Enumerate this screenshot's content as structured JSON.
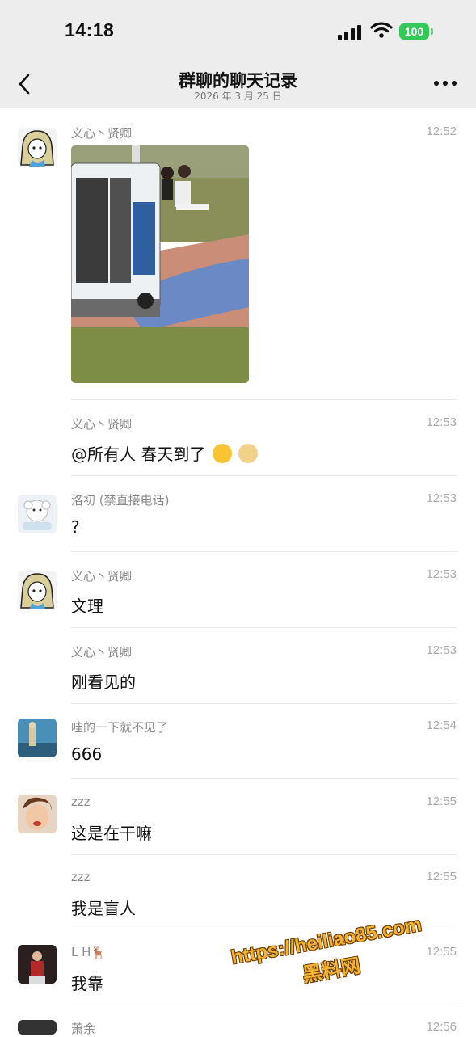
{
  "status_bar": {
    "time": "14:18",
    "battery": "100"
  },
  "nav": {
    "title": "群聊的聊天记录",
    "subtitle": "2026 年 3 月 25 日",
    "back_icon": "chevron-left-icon",
    "more_icon": "more-dots-icon"
  },
  "messages": [
    {
      "sender": "义心丶贤卿",
      "time": "12:52",
      "type": "image"
    },
    {
      "sender": "义心丶贤卿",
      "time": "12:53",
      "text": "@所有人 春天到了",
      "emojis": [
        "laugh-cry-emoji",
        "doge-emoji"
      ]
    },
    {
      "sender": "洛初 (禁直接电话)",
      "time": "12:53",
      "text": "?"
    },
    {
      "sender": "义心丶贤卿",
      "time": "12:53",
      "text": "文理"
    },
    {
      "sender": "义心丶贤卿",
      "time": "12:53",
      "text": "刚看见的"
    },
    {
      "sender": "哇的一下就不见了",
      "time": "12:54",
      "text": "666"
    },
    {
      "sender": "zzz",
      "time": "12:55",
      "text": "这是在干嘛"
    },
    {
      "sender": "zzz",
      "time": "12:55",
      "text": "我是盲人"
    },
    {
      "sender": "L H🦌",
      "time": "12:55",
      "text": "我靠"
    },
    {
      "sender": "萧余",
      "time": "12:56",
      "text": ""
    }
  ],
  "watermark": {
    "url": "https://heiliao85.com",
    "name": "黑料网"
  },
  "colors": {
    "background": "#ffffff",
    "header": "#ededed",
    "battery": "#34c759",
    "watermark": "#f2b233"
  }
}
